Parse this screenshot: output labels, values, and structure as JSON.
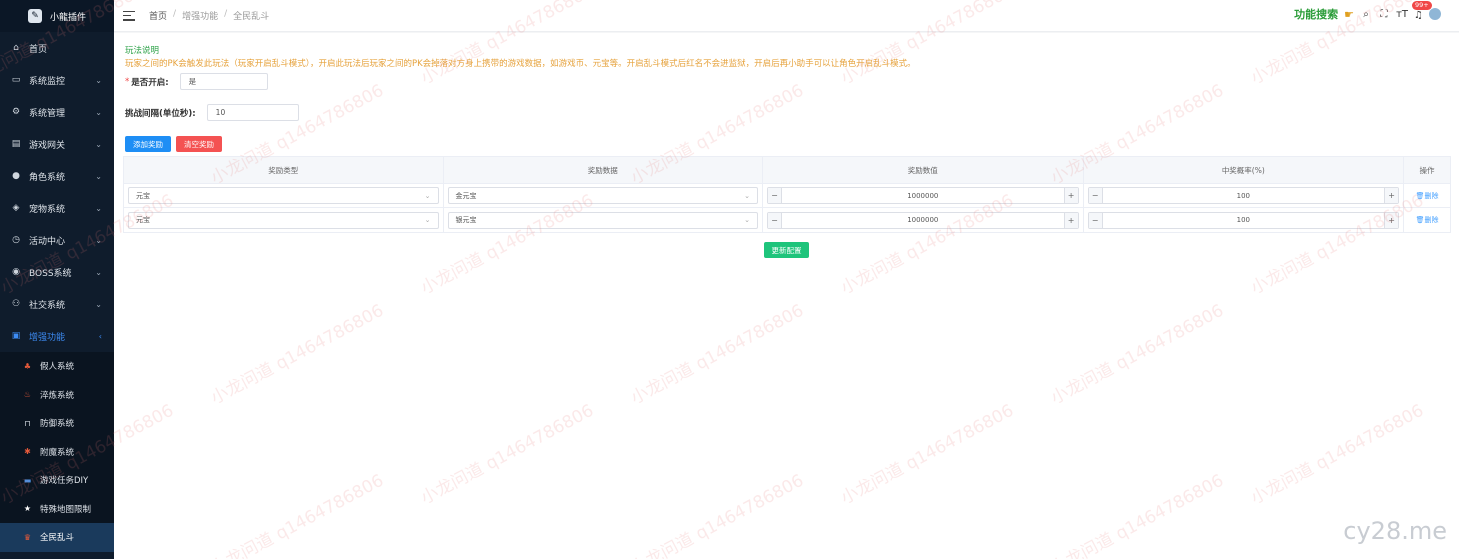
{
  "sidebar": {
    "brand": "小龍插件",
    "menu": [
      {
        "label": "首页",
        "icon": "dashboard-icon",
        "glyph": "⌂",
        "has_chevron": false
      },
      {
        "label": "系统监控",
        "icon": "monitor-icon",
        "glyph": "▭",
        "has_chevron": true
      },
      {
        "label": "系统管理",
        "icon": "gear-icon",
        "glyph": "⚙",
        "has_chevron": true
      },
      {
        "label": "游戏网关",
        "icon": "gateway-icon",
        "glyph": "▤",
        "has_chevron": true
      },
      {
        "label": "角色系统",
        "icon": "user-icon",
        "glyph": "●",
        "has_chevron": true
      },
      {
        "label": "宠物系统",
        "icon": "pet-icon",
        "glyph": "◈",
        "has_chevron": true
      },
      {
        "label": "活动中心",
        "icon": "clock-icon",
        "glyph": "◷",
        "has_chevron": true
      },
      {
        "label": "BOSS系统",
        "icon": "boss-icon",
        "glyph": "◉",
        "has_chevron": true
      },
      {
        "label": "社交系统",
        "icon": "social-icon",
        "glyph": "⚇",
        "has_chevron": true
      },
      {
        "label": "增强功能",
        "icon": "toolbox-icon",
        "glyph": "▣",
        "has_chevron": true
      }
    ],
    "submenu": [
      {
        "label": "假人系统",
        "icon": "robot-icon",
        "glyph": "♣"
      },
      {
        "label": "淬炼系统",
        "icon": "fire-icon",
        "glyph": "♨"
      },
      {
        "label": "防御系统",
        "icon": "lock-icon",
        "glyph": "⊓"
      },
      {
        "label": "附魔系统",
        "icon": "magic-icon",
        "glyph": "✱"
      },
      {
        "label": "游戏任务DIY",
        "icon": "task-icon",
        "glyph": "▬"
      },
      {
        "label": "特殊地图限制",
        "icon": "star-icon",
        "glyph": "★"
      },
      {
        "label": "全民乱斗",
        "icon": "brawl-icon",
        "glyph": "♛"
      }
    ]
  },
  "header": {
    "breadcrumb": [
      "首页",
      "增强功能",
      "全民乱斗"
    ],
    "func_search": "功能搜索",
    "badge": "99+"
  },
  "content": {
    "intro_title": "玩法说明",
    "intro_text": "玩家之间的PK会触发此玩法（玩家开启乱斗模式），开启此玩法后玩家之间的PK会掉落对方身上携带的游戏数据，如游戏币、元宝等。开启乱斗模式后红名不会进监狱，开启后再小助手可以让角色开启乱斗模式。",
    "enable_label": "是否开启:",
    "enable_value": "是",
    "interval_label": "挑战间隔(单位秒):",
    "interval_value": "10",
    "add_reward": "添加奖励",
    "clear_reward": "清空奖励",
    "update_config": "更新配置",
    "table": {
      "headers": [
        "奖励类型",
        "奖励数据",
        "奖励数值",
        "中奖概率(%)",
        "操作"
      ],
      "rows": [
        {
          "type": "元宝",
          "data": "金元宝",
          "amount": "1000000",
          "prob": "100",
          "action": "删除"
        },
        {
          "type": "元宝",
          "data": "银元宝",
          "amount": "1000000",
          "prob": "100",
          "action": "删除"
        }
      ]
    }
  },
  "watermark": {
    "text": "小龙问道 q1464786806",
    "corner": "cy28.me"
  }
}
